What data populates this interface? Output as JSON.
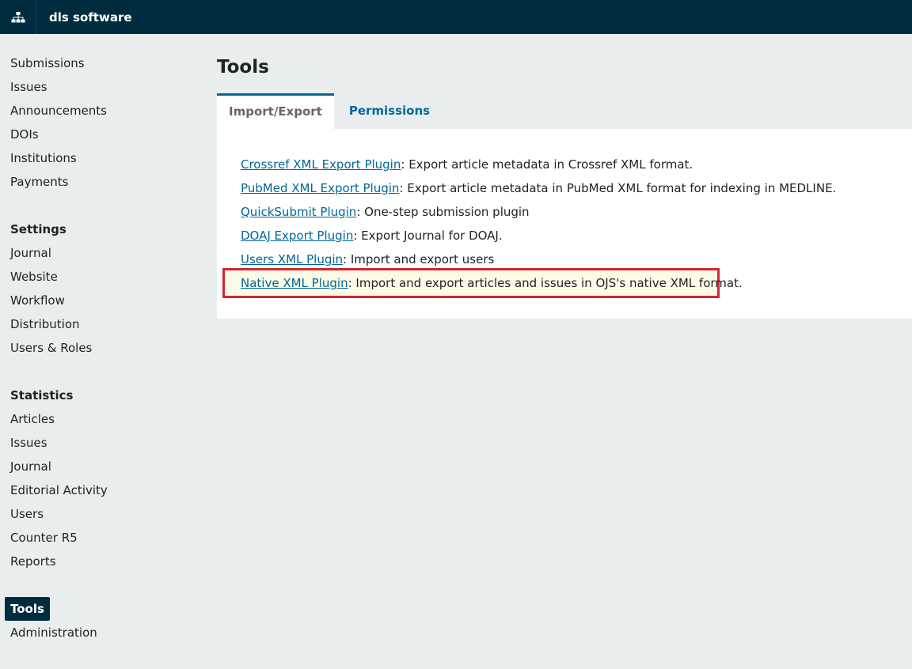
{
  "header": {
    "site_name": "dls software",
    "home_icon": "sitemap-icon"
  },
  "sidebar": {
    "main_items": [
      {
        "label": "Submissions"
      },
      {
        "label": "Issues"
      },
      {
        "label": "Announcements"
      },
      {
        "label": "DOIs"
      },
      {
        "label": "Institutions"
      },
      {
        "label": "Payments"
      }
    ],
    "settings": {
      "heading": "Settings",
      "items": [
        {
          "label": "Journal"
        },
        {
          "label": "Website"
        },
        {
          "label": "Workflow"
        },
        {
          "label": "Distribution"
        },
        {
          "label": "Users & Roles"
        }
      ]
    },
    "statistics": {
      "heading": "Statistics",
      "items": [
        {
          "label": "Articles"
        },
        {
          "label": "Issues"
        },
        {
          "label": "Journal"
        },
        {
          "label": "Editorial Activity"
        },
        {
          "label": "Users"
        },
        {
          "label": "Counter R5"
        },
        {
          "label": "Reports"
        }
      ]
    },
    "tools_label": "Tools",
    "administration_label": "Administration"
  },
  "main": {
    "title": "Tools",
    "tabs": [
      {
        "label": "Import/Export",
        "active": true
      },
      {
        "label": "Permissions",
        "active": false
      }
    ],
    "plugins": [
      {
        "name": "Crossref XML Export Plugin",
        "description": ": Export article metadata in Crossref XML format."
      },
      {
        "name": "PubMed XML Export Plugin",
        "description": ": Export article metadata in PubMed XML format for indexing in MEDLINE."
      },
      {
        "name": "QuickSubmit Plugin",
        "description": ": One-step submission plugin"
      },
      {
        "name": "DOAJ Export Plugin",
        "description": ": Export Journal for DOAJ."
      },
      {
        "name": "Users XML Plugin",
        "description": ": Import and export users"
      },
      {
        "name": "Native XML Plugin",
        "description": ": Import and export articles and issues in OJS's native XML format.",
        "highlighted": true
      }
    ]
  },
  "colors": {
    "header_bg": "#002c40",
    "link": "#006798",
    "highlight_border": "#d22630",
    "highlight_bg": "#fcfbe8"
  }
}
